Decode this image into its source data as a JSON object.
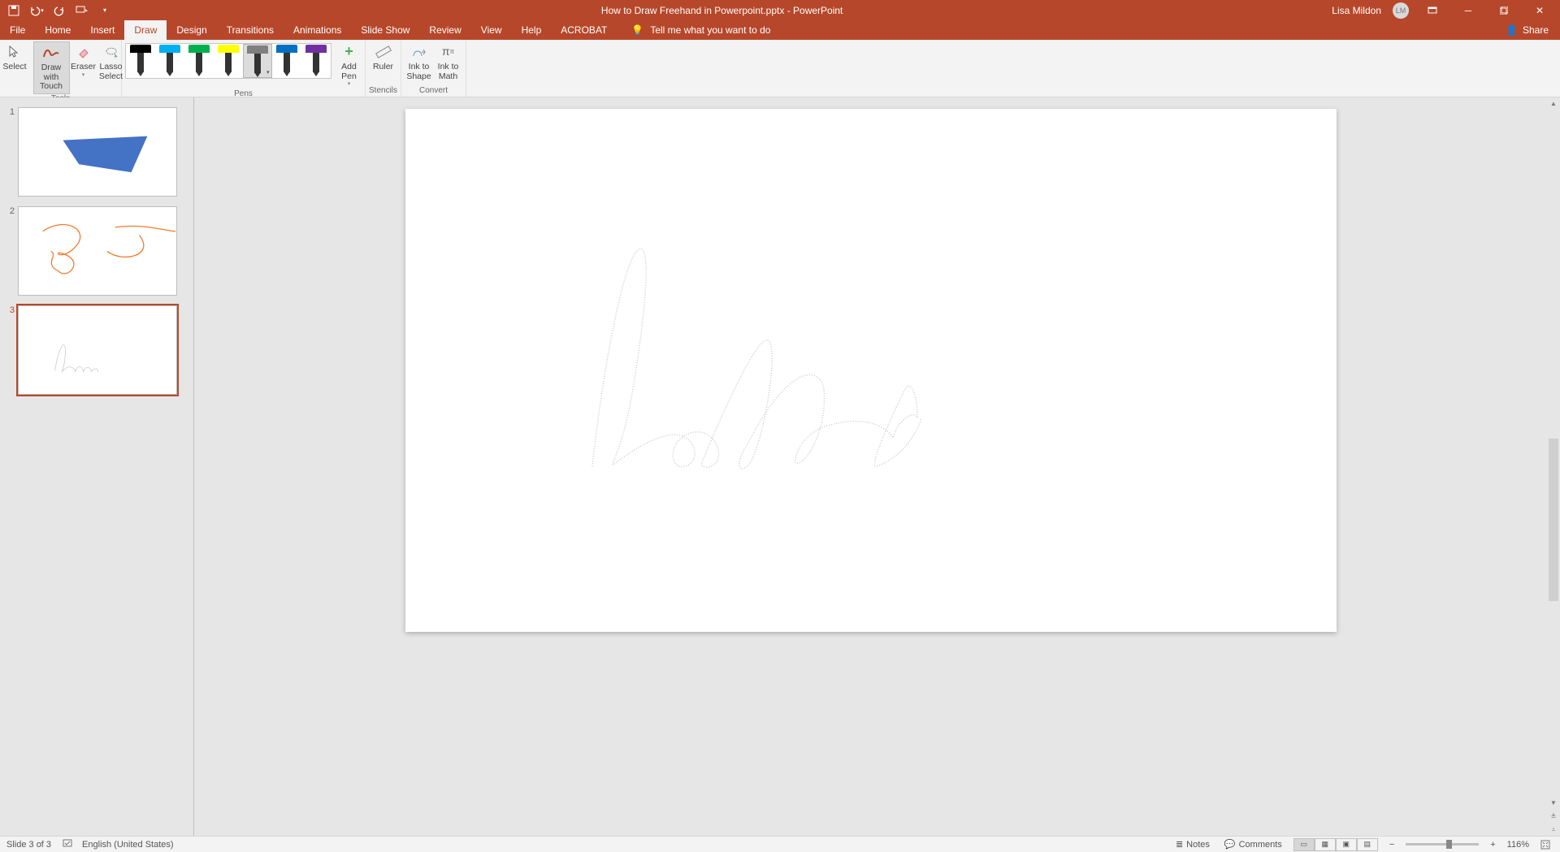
{
  "titlebar": {
    "document": "How to Draw Freehand in Powerpoint.pptx",
    "app_suffix": "  -  PowerPoint",
    "user": "Lisa Mildon",
    "avatar_initials": "LM"
  },
  "tabs": {
    "items": [
      "File",
      "Home",
      "Insert",
      "Draw",
      "Design",
      "Transitions",
      "Animations",
      "Slide Show",
      "Review",
      "View",
      "Help",
      "ACROBAT"
    ],
    "active_index": 3,
    "tell_me": "Tell me what you want to do",
    "share": "Share"
  },
  "ribbon": {
    "tools": {
      "label": "Tools",
      "select": "Select",
      "draw_touch": "Draw with Touch",
      "eraser": "Eraser",
      "lasso": "Lasso Select"
    },
    "pens": {
      "label": "Pens",
      "tips": [
        "#000000",
        "#00b0f0",
        "#00b050",
        "#ffff00",
        "#7f7f7f",
        "#0070c0",
        "#7030a0"
      ],
      "selected_index": 4,
      "add_pen": "Add Pen"
    },
    "stencils": {
      "label": "Stencils",
      "ruler": "Ruler"
    },
    "convert": {
      "label": "Convert",
      "ink_shape": "Ink to Shape",
      "ink_math": "Ink to Math"
    }
  },
  "slides": {
    "count": 3,
    "active_index": 3
  },
  "statusbar": {
    "slide_info": "Slide 3 of 3",
    "language": "English (United States)",
    "notes": "Notes",
    "comments": "Comments",
    "zoom": "116%"
  }
}
